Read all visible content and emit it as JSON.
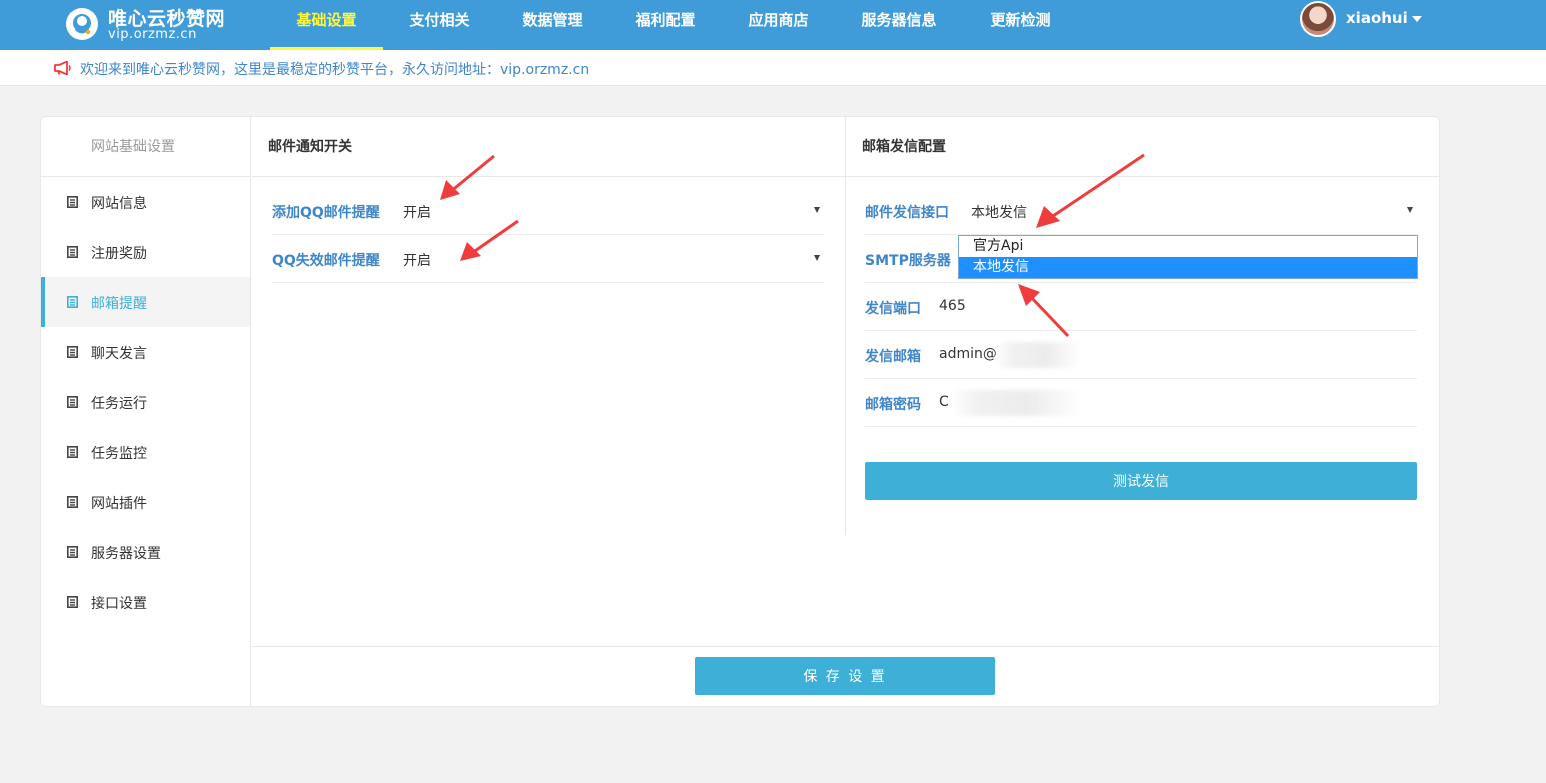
{
  "brand": {
    "title": "唯心云秒赞网",
    "url": "vip.orzmz.cn"
  },
  "nav": {
    "items": [
      {
        "label": "基础设置",
        "active": true
      },
      {
        "label": "支付相关"
      },
      {
        "label": "数据管理"
      },
      {
        "label": "福利配置"
      },
      {
        "label": "应用商店"
      },
      {
        "label": "服务器信息"
      },
      {
        "label": "更新检测"
      }
    ],
    "user": "xiaohui"
  },
  "notice": {
    "text": "欢迎来到唯心云秒赞网，这里是最稳定的秒赞平台，永久访问地址：vip.orzmz.cn"
  },
  "sidebar": {
    "title": "网站基础设置",
    "items": [
      {
        "label": "网站信息"
      },
      {
        "label": "注册奖励"
      },
      {
        "label": "邮箱提醒",
        "active": true
      },
      {
        "label": "聊天发言"
      },
      {
        "label": "任务运行"
      },
      {
        "label": "任务监控"
      },
      {
        "label": "网站插件"
      },
      {
        "label": "服务器设置"
      },
      {
        "label": "接口设置"
      }
    ]
  },
  "notify_panel": {
    "title": "邮件通知开关",
    "fields": [
      {
        "label": "添加QQ邮件提醒",
        "value": "开启"
      },
      {
        "label": "QQ失效邮件提醒",
        "value": "开启"
      }
    ]
  },
  "mail_panel": {
    "title": "邮箱发信配置",
    "interface": {
      "label": "邮件发信接口",
      "value": "本地发信"
    },
    "dropdown_options": [
      {
        "label": "官方Api"
      },
      {
        "label": "本地发信",
        "selected": true
      }
    ],
    "smtp": {
      "label": "SMTP服务器",
      "value": ""
    },
    "port": {
      "label": "发信端口",
      "value": "465"
    },
    "email": {
      "label": "发信邮箱",
      "value": "admin@"
    },
    "password": {
      "label": "邮箱密码",
      "value": "C"
    },
    "test_button": "测试发信"
  },
  "save_button": "保 存 设 置",
  "colors": {
    "nav_bg": "#3f9cd8",
    "nav_active": "#fff83a",
    "accent": "#3eb0d8",
    "label_blue": "#3f86c9",
    "dropdown_selected": "#1e90ff",
    "annotation_arrow": "#f03c3c"
  },
  "icons": {
    "notice": "megaphone-icon",
    "sidebar": "document-icon",
    "user_menu": "chevron-down-icon",
    "select": "caret-down-icon"
  }
}
